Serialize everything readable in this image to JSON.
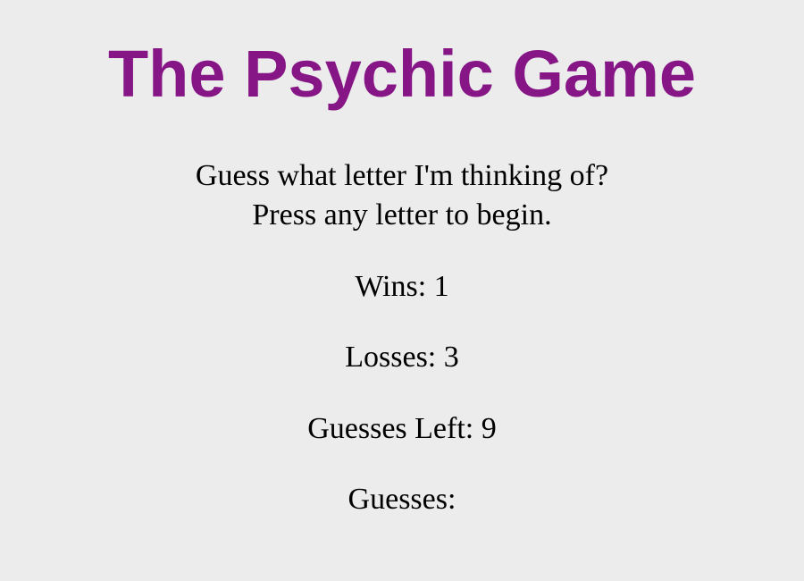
{
  "title": {
    "text": "The Psychic Game",
    "color": "#861686"
  },
  "instructions": {
    "line1": "Guess what letter I'm thinking of?",
    "line2": "Press any letter to begin."
  },
  "stats": {
    "wins_label": "Wins:",
    "wins_value": "1",
    "losses_label": "Losses:",
    "losses_value": "3",
    "guesses_left_label": "Guesses Left:",
    "guesses_left_value": "9",
    "guesses_label": "Guesses:",
    "guesses_value": ""
  },
  "colors": {
    "background": "#ececec",
    "text": "#000000"
  }
}
